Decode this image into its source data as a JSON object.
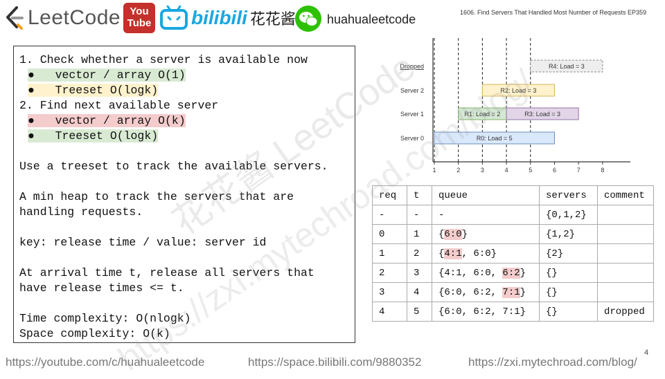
{
  "header": {
    "brand": "LeetCode",
    "youtube_top": "You",
    "youtube_bottom": "Tube",
    "bilibili": "bilibili",
    "chinese_name": "花花酱",
    "handle": "huahualeetcode",
    "episode_title": "1606. Find Servers That Handled Most Number of Requests EP359"
  },
  "notes": {
    "lines": [
      {
        "text": "1. Check whether a server is available now",
        "hl": ""
      },
      {
        "text": "●   vector / array O(1)",
        "hl": "green",
        "indent": true
      },
      {
        "text": "●   Treeset O(logk)",
        "hl": "yellow",
        "indent": true
      },
      {
        "text": "2. Find next available server",
        "hl": ""
      },
      {
        "text": "●   vector / array O(k)",
        "hl": "red",
        "indent": true
      },
      {
        "text": "●   Treeset O(logk)",
        "hl": "green",
        "indent": true
      },
      {
        "text": "",
        "hl": ""
      },
      {
        "text": "Use a treeset to track the available servers.",
        "hl": ""
      },
      {
        "text": "",
        "hl": ""
      },
      {
        "text": "A min heap to track the servers that are",
        "hl": ""
      },
      {
        "text": "handling requests.",
        "hl": ""
      },
      {
        "text": "",
        "hl": ""
      },
      {
        "text": "key: release time / value: server id",
        "hl": ""
      },
      {
        "text": "",
        "hl": ""
      },
      {
        "text": "At arrival time t, release all servers that",
        "hl": ""
      },
      {
        "text": "have release times <= t.",
        "hl": ""
      },
      {
        "text": "",
        "hl": ""
      },
      {
        "text": "Time complexity: O(nlogk)",
        "hl": ""
      },
      {
        "text": "Space complexity: O(k)",
        "hl": ""
      }
    ]
  },
  "timeline": {
    "rows": [
      "Dropped",
      "Server 2",
      "Server 1",
      "Server 0"
    ],
    "x_ticks": [
      "1",
      "2",
      "3",
      "4",
      "5",
      "6",
      "7",
      "8"
    ],
    "bars": [
      {
        "row": 0,
        "start": 5,
        "end": 8,
        "label": "R4: Load = 3",
        "color": "#eeeeee",
        "stroke": "#888888",
        "dashed": true
      },
      {
        "row": 1,
        "start": 3,
        "end": 6,
        "label": "R2: Load = 3",
        "color": "#fff2cc",
        "stroke": "#d6b656",
        "dashed": false
      },
      {
        "row": 2,
        "start": 2,
        "end": 4,
        "label": "R1: Load = 2",
        "color": "#d5e8d4",
        "stroke": "#82b366",
        "dashed": false
      },
      {
        "row": 2,
        "start": 4,
        "end": 7,
        "label": "R3: Load = 3",
        "color": "#e1d5e7",
        "stroke": "#9673a6",
        "dashed": false
      },
      {
        "row": 3,
        "start": 1,
        "end": 6,
        "label": "R0: Load = 5",
        "color": "#dae8fc",
        "stroke": "#6c8ebf",
        "dashed": false
      }
    ],
    "dashed_lines_at": [
      1,
      2,
      3,
      4,
      5
    ]
  },
  "table": {
    "headers": [
      "req",
      "t",
      "queue",
      "servers",
      "comment"
    ],
    "rows": [
      {
        "req": "-",
        "t": "-",
        "queue": [
          {
            "s": "-",
            "hl": false
          }
        ],
        "servers": "{0,1,2}",
        "comment": ""
      },
      {
        "req": "0",
        "t": "1",
        "queue": [
          {
            "s": "{",
            "hl": false
          },
          {
            "s": "6:0",
            "hl": true
          },
          {
            "s": "}",
            "hl": false
          }
        ],
        "servers": "{1,2}",
        "comment": ""
      },
      {
        "req": "1",
        "t": "2",
        "queue": [
          {
            "s": "{",
            "hl": false
          },
          {
            "s": "4:1",
            "hl": true
          },
          {
            "s": ", 6:0}",
            "hl": false
          }
        ],
        "servers": "{2}",
        "comment": ""
      },
      {
        "req": "2",
        "t": "3",
        "queue": [
          {
            "s": "{4:1, 6:0, ",
            "hl": false
          },
          {
            "s": "6:2",
            "hl": true
          },
          {
            "s": "}",
            "hl": false
          }
        ],
        "servers": "{}",
        "comment": ""
      },
      {
        "req": "3",
        "t": "4",
        "queue": [
          {
            "s": "{6:0, 6:2, ",
            "hl": false
          },
          {
            "s": "7:1",
            "hl": true
          },
          {
            "s": "}",
            "hl": false
          }
        ],
        "servers": "{}",
        "comment": ""
      },
      {
        "req": "4",
        "t": "5",
        "queue": [
          {
            "s": "{6:0, 6:2, 7:1}",
            "hl": false
          }
        ],
        "servers": "{}",
        "comment": "dropped"
      }
    ]
  },
  "footer": {
    "youtube_url": "https://youtube.com/c/huahualeetcode",
    "bilibili_url": "https://space.bilibili.com/9880352",
    "blog_url": "https://zxi.mytechroad.com/blog/",
    "page_number": "4"
  },
  "watermark": {
    "line1": "花花酱 LeetCode",
    "line2": "https://zxi.mytechroad.com/blog/"
  }
}
